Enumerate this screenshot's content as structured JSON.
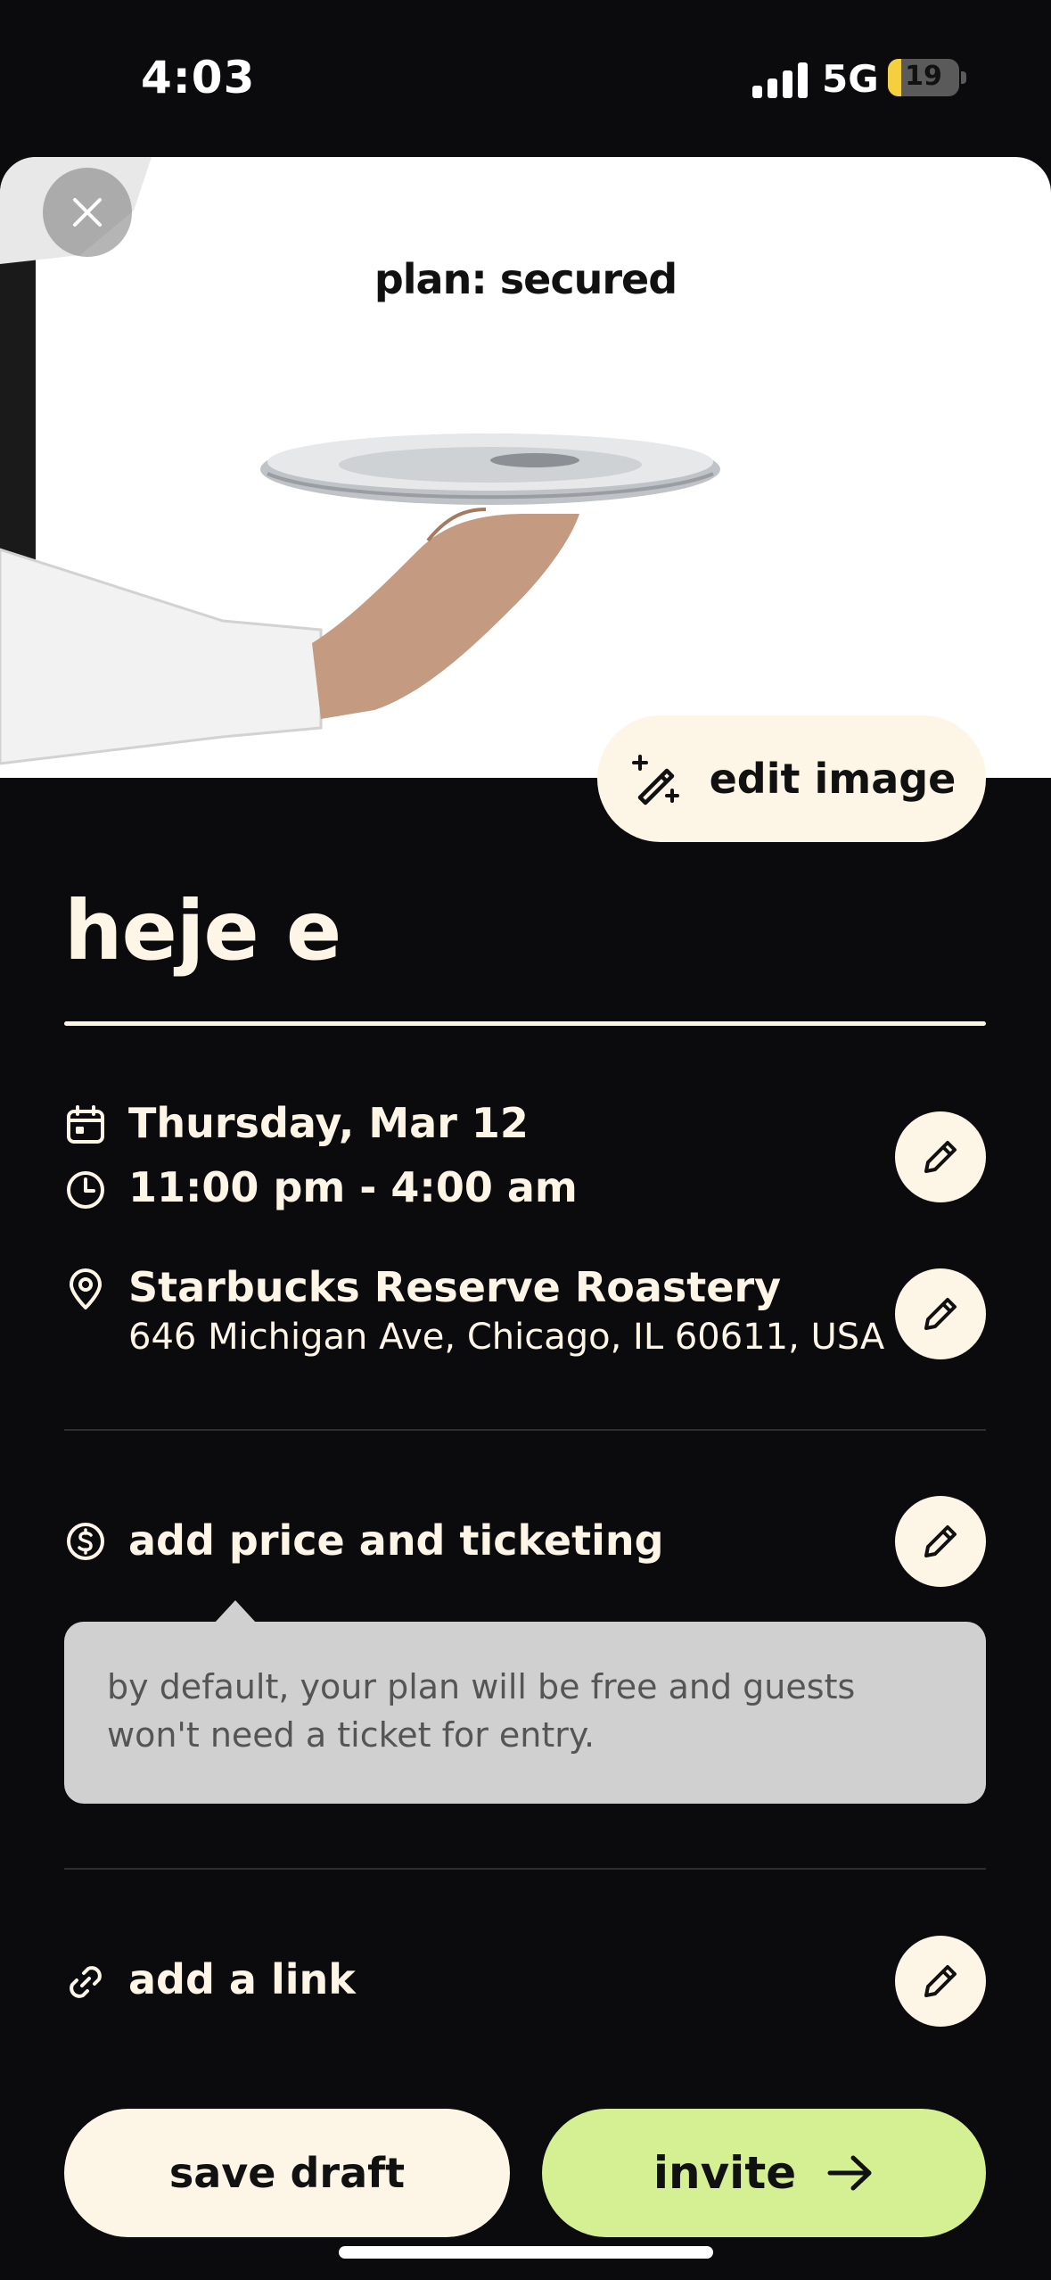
{
  "status_bar": {
    "time": "4:03",
    "network": "5G",
    "battery": "19",
    "battery_level": 0.19
  },
  "cover": {
    "title": "plan: secured",
    "edit_image_label": "edit image"
  },
  "event": {
    "title": "heje e",
    "date": "Thursday, Mar 12",
    "time": "11:00 pm - 4:00 am",
    "venue_name": "Starbucks Reserve Roastery",
    "venue_address": "646 Michigan Ave, Chicago, IL 60611, USA"
  },
  "ticketing": {
    "label": "add price and ticketing",
    "tooltip": "by default, your plan will be free and guests won't need a ticket for entry."
  },
  "link": {
    "label": "add a link"
  },
  "actions": {
    "save_draft": "save draft",
    "invite": "invite"
  },
  "colors": {
    "background": "#0b0b0d",
    "cream": "#fdf6e7",
    "accent_green": "#d5ef93",
    "tooltip_bg": "#d0d0d0"
  }
}
